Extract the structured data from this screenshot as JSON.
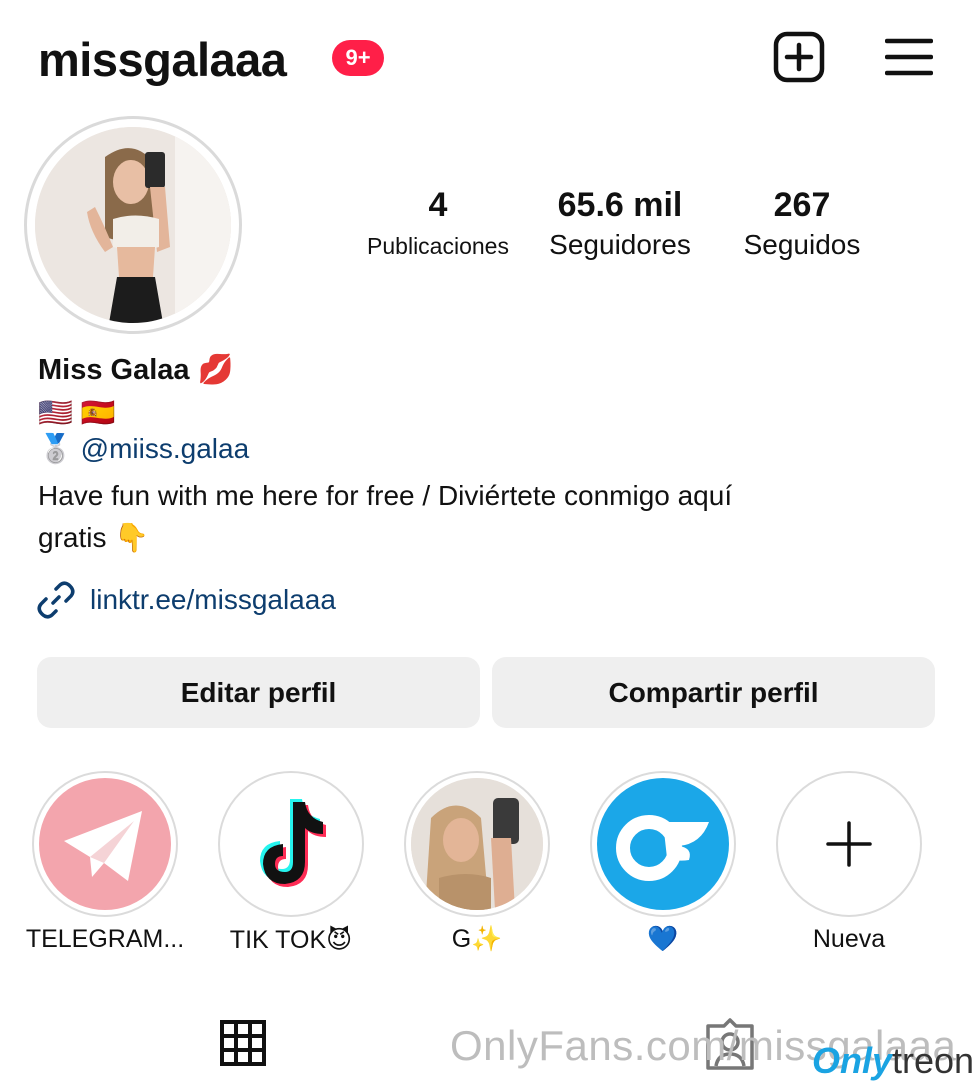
{
  "header": {
    "username": "missgalaaa",
    "notification_badge": "9+",
    "new_post_icon": "plus-square-icon",
    "menu_icon": "hamburger-menu-icon"
  },
  "stats": [
    {
      "number": "4",
      "label": "Publicaciones"
    },
    {
      "number": "65.6 mil",
      "label": "Seguidores"
    },
    {
      "number": "267",
      "label": "Seguidos"
    }
  ],
  "bio": {
    "full_name": "Miss Galaa",
    "full_name_emoji": "💋",
    "flags": "🇺🇸 🇪🇸",
    "mention_emoji": "🥈",
    "mention": "@miiss.galaa",
    "text_line1": "Have fun with me here for free / Diviértete conmigo aquí",
    "text_line2": "gratis 👇",
    "link": "linktr.ee/missgalaaa"
  },
  "buttons": {
    "edit": "Editar perfil",
    "share": "Compartir perfil"
  },
  "highlights": [
    {
      "label": "TELEGRAM...",
      "icon": "telegram-icon"
    },
    {
      "label": "TIK TOK😈",
      "icon": "tiktok-icon"
    },
    {
      "label": "G✨",
      "icon": "photo"
    },
    {
      "label": "💙",
      "icon": "onlyfans-icon"
    },
    {
      "label": "Nueva",
      "icon": "plus-icon"
    }
  ],
  "tabs": {
    "grid_icon": "grid-icon",
    "tagged_icon": "tagged-person-icon"
  },
  "watermark": {
    "text": "OnlyFans.com/missgalaaa",
    "logo_only": "Only",
    "logo_treon": "treon"
  },
  "colors": {
    "badge": "#ff1f48",
    "link": "#0d3d6e",
    "button_bg": "#efefef",
    "telegram_bg": "#f3a5ad",
    "onlyfans_blue": "#1ba7e8"
  }
}
